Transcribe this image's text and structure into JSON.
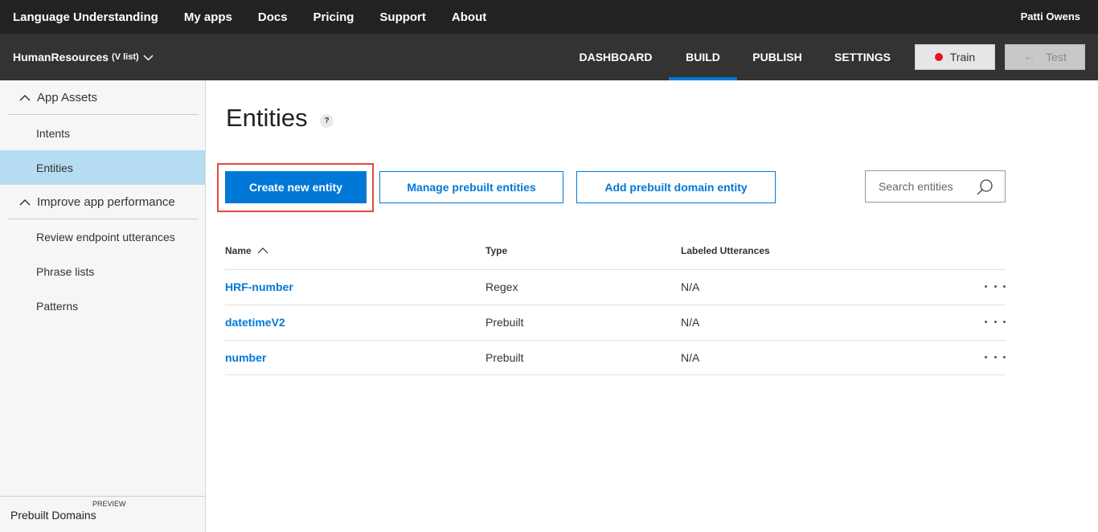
{
  "topnav": {
    "brand": "Language Understanding",
    "links": [
      "My apps",
      "Docs",
      "Pricing",
      "Support",
      "About"
    ],
    "user": "Patti Owens"
  },
  "appbar": {
    "app_name": "HumanResources",
    "version": "(V list)",
    "tabs": [
      "DASHBOARD",
      "BUILD",
      "PUBLISH",
      "SETTINGS"
    ],
    "active_tab": "BUILD",
    "train_label": "Train",
    "test_label": "Test"
  },
  "sidebar": {
    "sections": [
      {
        "label": "App Assets",
        "items": [
          "Intents",
          "Entities"
        ]
      },
      {
        "label": "Improve app performance",
        "items": [
          "Review endpoint utterances",
          "Phrase lists",
          "Patterns"
        ]
      }
    ],
    "active_item": "Entities",
    "footer_label": "Prebuilt Domains",
    "footer_badge": "PREVIEW"
  },
  "main": {
    "title": "Entities",
    "help_glyph": "?",
    "buttons": {
      "create": "Create new entity",
      "manage_prebuilt": "Manage prebuilt entities",
      "add_domain": "Add prebuilt domain entity"
    },
    "search_placeholder": "Search entities",
    "table": {
      "columns": [
        "Name",
        "Type",
        "Labeled Utterances"
      ],
      "rows": [
        {
          "name": "HRF-number",
          "type": "Regex",
          "labeled": "N/A"
        },
        {
          "name": "datetimeV2",
          "type": "Prebuilt",
          "labeled": "N/A"
        },
        {
          "name": "number",
          "type": "Prebuilt",
          "labeled": "N/A"
        }
      ]
    }
  },
  "colors": {
    "accent": "#0078d7",
    "topnav_bg": "#222222",
    "appbar_bg": "#333333",
    "active_sidebar": "#b6dcf2",
    "highlight_box": "#e04a3f",
    "train_dot": "#e81123"
  }
}
